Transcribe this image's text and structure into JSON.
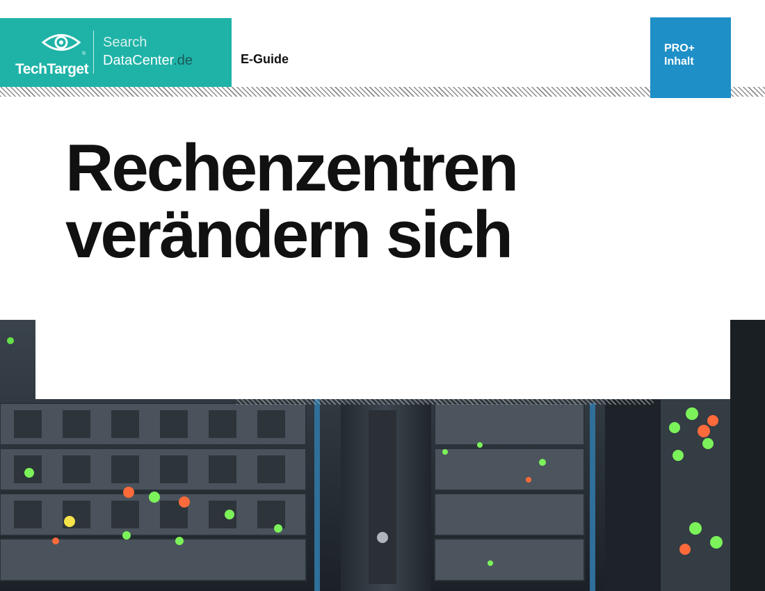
{
  "header": {
    "brand_techtarget": "TechTarget",
    "brand_registered": "®",
    "brand_site_line1": "Search",
    "brand_site_line2": "DataCenter",
    "brand_site_tld": ".de",
    "doc_type": "E-Guide",
    "badge_line1": "PRO+",
    "badge_line2": "Inhalt"
  },
  "title": {
    "line1": "Rechenzentren",
    "line2": "verändern sich"
  },
  "icons": {
    "logo": "eye-icon"
  },
  "colors": {
    "logo_teal": "#1fb3a7",
    "badge_blue": "#1e8fc7",
    "title_text": "#111111"
  }
}
